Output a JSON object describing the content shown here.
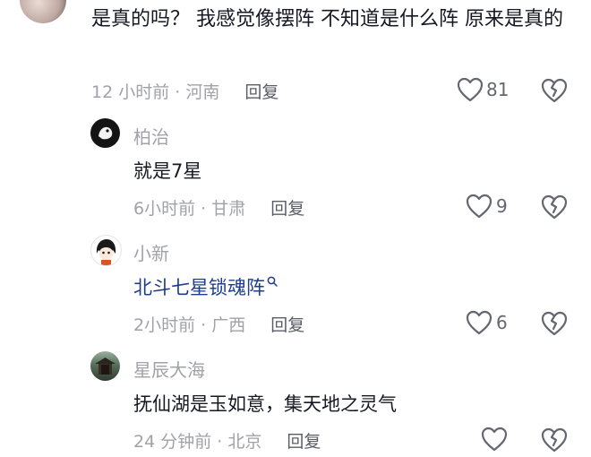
{
  "comment": {
    "text": "是真的吗？ 我感觉像摆阵  不知道是什么阵  原来是真的",
    "time_location": "12 小时前 · 河南",
    "reply_label": "回复",
    "likes": "81"
  },
  "replies": [
    {
      "name": "柏治",
      "text": "就是7星",
      "time_location": "6小时前 · 甘肃",
      "reply_label": "回复",
      "likes": "9"
    },
    {
      "name": "小新",
      "text": "北斗七星锁魂阵",
      "time_location": "2小时前 · 广西",
      "reply_label": "回复",
      "likes": "6"
    },
    {
      "name": "星辰大海",
      "text": "抚仙湖是玉如意，集天地之灵气",
      "time_location": "24 分钟前 · 北京",
      "reply_label": "回复",
      "likes": ""
    }
  ],
  "icons": {
    "like": "heart-outline-icon",
    "dislike": "broken-heart-icon",
    "search": "search-icon"
  },
  "colors": {
    "text": "#161823",
    "meta": "#a1a2a7",
    "link": "#1f3d8f"
  }
}
